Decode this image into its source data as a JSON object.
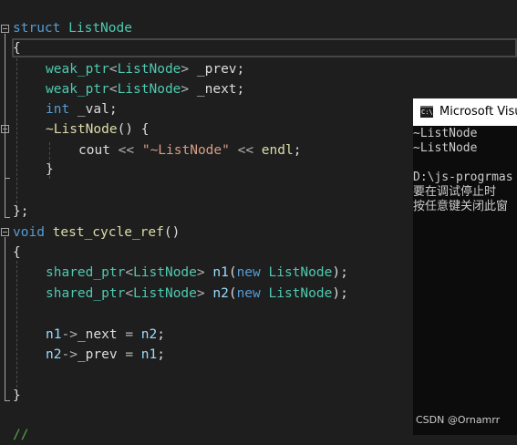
{
  "code": {
    "l1": {
      "kw": "struct",
      "name": "ListNode"
    },
    "l2": {
      "brace": "{"
    },
    "l3": {
      "tpl": "weak_ptr",
      "lt": "<",
      "type": "ListNode",
      "gt": ">",
      "var": " _prev",
      "semi": ";"
    },
    "l4": {
      "tpl": "weak_ptr",
      "lt": "<",
      "type": "ListNode",
      "gt": ">",
      "var": " _next",
      "semi": ";"
    },
    "l5": {
      "kw": "int",
      "var": " _val",
      "semi": ";"
    },
    "l6": {
      "name": "~ListNode",
      "parens": "() {"
    },
    "l7": {
      "id": "cout",
      "op1": " << ",
      "str": "\"~ListNode\"",
      "op2": " << ",
      "endl": "endl",
      "semi": ";"
    },
    "l8": {
      "brace": "}"
    },
    "l10": {
      "text": "};"
    },
    "l11": {
      "kw": "void",
      "name": " test_cycle_ref",
      "parens": "()"
    },
    "l12": {
      "brace": "{"
    },
    "l14": {
      "tpl": "shared_ptr",
      "lt": "<",
      "type": "ListNode",
      "gt": ">",
      "var": " n1",
      "open": "(",
      "kwnew": "new",
      "type2": " ListNode",
      "close": ");"
    },
    "l15": {
      "tpl": "shared_ptr",
      "lt": "<",
      "type": "ListNode",
      "gt": ">",
      "var": " n2",
      "open": "(",
      "kwnew": "new",
      "type2": " ListNode",
      "close": ");"
    },
    "l17": {
      "a": "n1",
      "arrow": "->",
      "field": "_next",
      "eq": " = ",
      "b": "n2",
      "semi": ";"
    },
    "l18": {
      "a": "n2",
      "arrow": "->",
      "field": "_prev",
      "eq": " = ",
      "b": "n1",
      "semi": ";"
    },
    "l20": {
      "brace": "}"
    },
    "l22": {
      "comment": "//"
    }
  },
  "console": {
    "title": "Microsoft Visual Studio 调试控制台",
    "icon_label": "C:\\",
    "lines": [
      "~ListNode",
      "~ListNode",
      "",
      "D:\\js-progrmas",
      "要在调试停止时",
      "按任意键关闭此窗"
    ],
    "watermark": "CSDN @Ornamrr"
  },
  "colors": {
    "editor_bg": "#1e1e1e",
    "keyword": "#569cd6",
    "type": "#4ec9b0",
    "function": "#dcdcaa",
    "identifier": "#9cdcfe",
    "string": "#d69d85",
    "comment": "#57a64a",
    "console_bg": "#0c0c0c"
  }
}
